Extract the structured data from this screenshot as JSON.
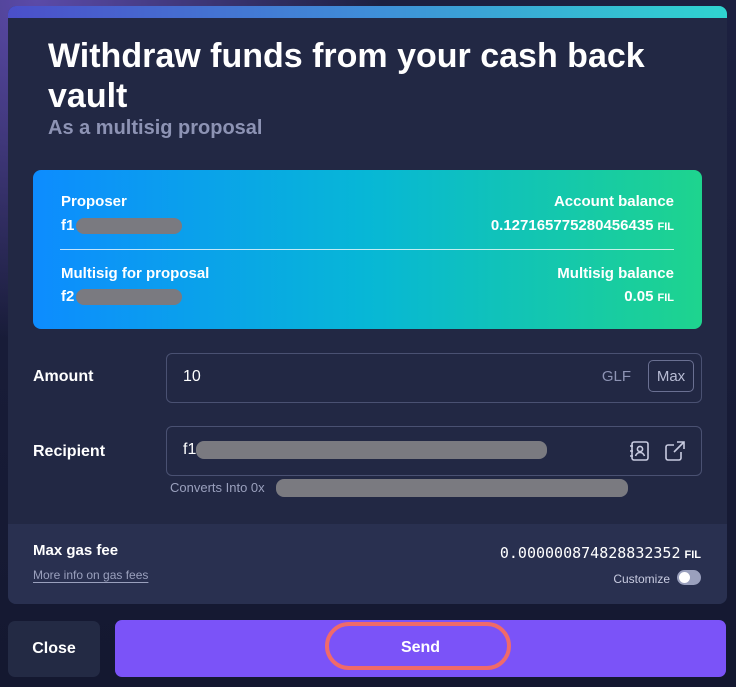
{
  "modal": {
    "title": "Withdraw funds from your cash back vault",
    "subtitle": "As a multisig proposal"
  },
  "info_card": {
    "proposer_label": "Proposer",
    "proposer_value_prefix": "f1",
    "account_balance_label": "Account balance",
    "account_balance_value": "0.12716577528045643​5",
    "account_balance_unit": "FIL",
    "multisig_label": "Multisig for proposal",
    "multisig_value_prefix": "f2",
    "multisig_balance_label": "Multisig balance",
    "multisig_balance_value": "0.05",
    "multisig_balance_unit": "FIL"
  },
  "amount": {
    "label": "Amount",
    "value": "10",
    "unit": "GLF",
    "max_label": "Max"
  },
  "recipient": {
    "label": "Recipient",
    "value_prefix": "f1",
    "converts_prefix": "Converts Into 0x"
  },
  "gas": {
    "label": "Max gas fee",
    "link": "More info on gas fees",
    "value": "0.000000874828832352",
    "unit": "FIL",
    "customize_label": "Customize",
    "customize_on": false
  },
  "footer": {
    "close_label": "Close",
    "send_label": "Send"
  },
  "colors": {
    "accent": "#7b53f8",
    "highlight": "#f06a6a",
    "card_gradient_start": "#0d8cff",
    "card_gradient_end": "#1ed48e"
  }
}
